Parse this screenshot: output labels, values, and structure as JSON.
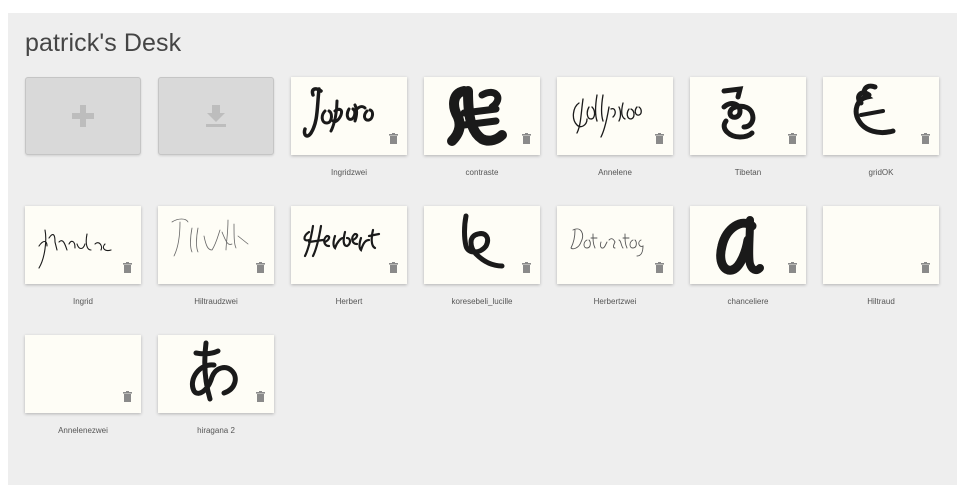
{
  "desk": {
    "title": "patrick's Desk",
    "actions": [
      {
        "name": "add-button",
        "icon": "plus-icon"
      },
      {
        "name": "download-button",
        "icon": "download-icon"
      }
    ],
    "fonts": [
      {
        "label": "Ingridzwei"
      },
      {
        "label": "contraste"
      },
      {
        "label": "Annelene"
      },
      {
        "label": "Tibetan"
      },
      {
        "label": "gridOK"
      },
      {
        "label": "Ingrid"
      },
      {
        "label": "Hiltraudzwei"
      },
      {
        "label": "Herbert"
      },
      {
        "label": "koresebeli_lucille"
      },
      {
        "label": "Herbertzwei"
      },
      {
        "label": "chanceliere"
      },
      {
        "label": "Hiltraud"
      },
      {
        "label": "Annelenezwei"
      },
      {
        "label": "hiragana 2"
      }
    ]
  },
  "colors": {
    "background": "#eeeeee",
    "card": "#fefdf6",
    "action_tile": "#d9d9d9",
    "action_icon": "#bdbdbd",
    "trash_icon": "#8a8a8a",
    "ink": "#1a1a1a"
  }
}
